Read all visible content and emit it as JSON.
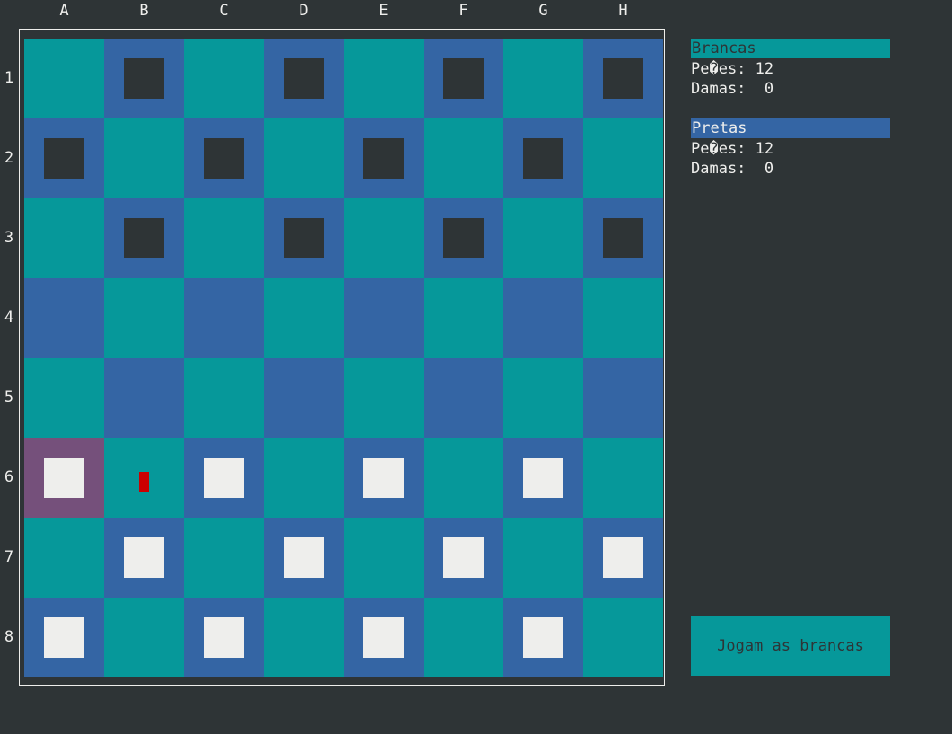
{
  "board": {
    "columns": [
      "A",
      "B",
      "C",
      "D",
      "E",
      "F",
      "G",
      "H"
    ],
    "rows": [
      "1",
      "2",
      "3",
      "4",
      "5",
      "6",
      "7",
      "8"
    ],
    "colors": {
      "light": "#06989a",
      "dark": "#3465a4",
      "selected": "#75507b",
      "black_piece": "#2e3436",
      "white_piece": "#eeeeec",
      "cursor": "#cc0000"
    },
    "black_pieces": [
      "B1",
      "D1",
      "F1",
      "H1",
      "A2",
      "C2",
      "E2",
      "G2",
      "B3",
      "D3",
      "F3",
      "H3"
    ],
    "white_pieces": [
      "A6",
      "C6",
      "E6",
      "G6",
      "B7",
      "D7",
      "F7",
      "H7",
      "A8",
      "C8",
      "E8",
      "G8"
    ],
    "selected_square": "A6",
    "cursor_square": "B6"
  },
  "panel": {
    "white": {
      "title": "Brancas",
      "pawns_line": "Pe�es: 12",
      "kings_line": "Damas:  0",
      "header_color": "#06989a",
      "title_color": "#2e3436"
    },
    "black": {
      "title": "Pretas",
      "pawns_line": "Pe�es: 12",
      "kings_line": "Damas:  0",
      "header_color": "#3465a4",
      "title_color": "#eeeeec"
    },
    "status": "Jogam as brancas"
  }
}
